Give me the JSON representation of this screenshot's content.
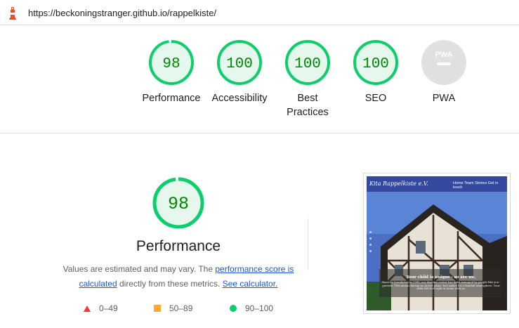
{
  "url_bar": {
    "url": "https://beckoningstranger.github.io/rappelkiste/",
    "icon": "lighthouse-icon"
  },
  "colors": {
    "pass": "#0cce6b",
    "pass_text": "#008800",
    "pass_fill": "#e6f8ed",
    "average": "#ffaa33",
    "fail": "#ff3333",
    "na": "#e0e0e0",
    "link": "#1a55d6"
  },
  "summary": {
    "gauges": [
      {
        "score": 98,
        "score_text": "98",
        "label": "Performance"
      },
      {
        "score": 100,
        "score_text": "100",
        "label": "Accessibility"
      },
      {
        "score": 100,
        "score_text": "100",
        "label": "Best Practices"
      },
      {
        "score": 100,
        "score_text": "100",
        "label": "SEO"
      },
      {
        "label": "PWA",
        "badge_text": "PWA",
        "icon": "pwa-badge-icon"
      }
    ]
  },
  "performance": {
    "score": 98,
    "score_text": "98",
    "title": "Performance",
    "desc_prefix": "Values are estimated and may vary. The ",
    "link_score": "performance score is calculated",
    "desc_middle": " directly from these metrics. ",
    "link_calc": "See calculator.",
    "legend": [
      {
        "range": "0–49",
        "shape": "triangle-icon"
      },
      {
        "range": "50–89",
        "shape": "square-icon"
      },
      {
        "range": "90–100",
        "shape": "circle-icon"
      }
    ]
  },
  "thumbnail": {
    "brand": "Kita Rappelkiste e.V.",
    "nav_links": "Home Team Stories Get in touch",
    "headline": "Your child is unique - so are we.",
    "body": "Since its foundation in 1990, our daycare center has been managed by people like you - parents. This means having no preset plans, but makes for a familial atmosphere. Your child will feel right at home with us."
  }
}
